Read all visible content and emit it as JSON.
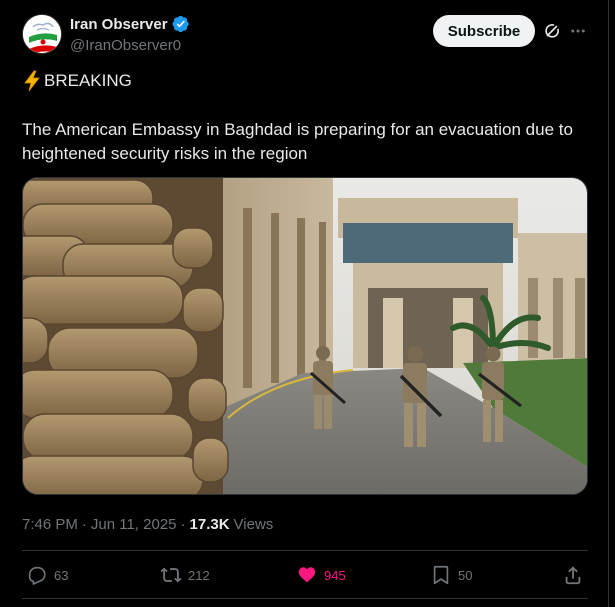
{
  "author": {
    "display_name": "Iran Observer",
    "handle": "@IranObserver0"
  },
  "header": {
    "subscribe_label": "Subscribe"
  },
  "tweet": {
    "headline": "BREAKING",
    "text": "The American Embassy in Baghdad is preparing for an evacuation due to heightened security risks in the region"
  },
  "meta": {
    "time": "7:46 PM",
    "separator": "·",
    "date": "Jun 11, 2025",
    "separator2": "·",
    "views_count": "17.3K",
    "views_label": "Views"
  },
  "actions": {
    "replies": "63",
    "reposts": "212",
    "likes": "945",
    "bookmarks": "50"
  },
  "colors": {
    "accent_blue": "#1d9bf0",
    "like_pink": "#f91880",
    "muted": "#71767b",
    "text": "#e7e9ea",
    "background": "#000000"
  },
  "icons": [
    "verified-badge-icon",
    "grok-icon",
    "more-icon",
    "lightning-icon",
    "reply-icon",
    "repost-icon",
    "heart-icon",
    "bookmark-icon",
    "share-icon"
  ]
}
